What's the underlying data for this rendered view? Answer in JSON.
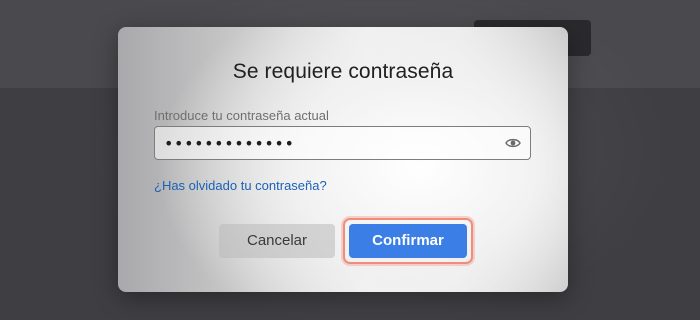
{
  "dialog": {
    "title": "Se requiere contraseña",
    "field_label": "Introduce tu contraseña actual",
    "password_value": "•••••••••••••",
    "forgot_link": "¿Has olvidado tu contraseña?",
    "cancel_label": "Cancelar",
    "confirm_label": "Confirmar"
  },
  "icons": {
    "reveal": "eye-icon"
  },
  "colors": {
    "accent": "#3a7ee6",
    "link": "#1a61b8",
    "focus_ring": "#f28c7a"
  }
}
